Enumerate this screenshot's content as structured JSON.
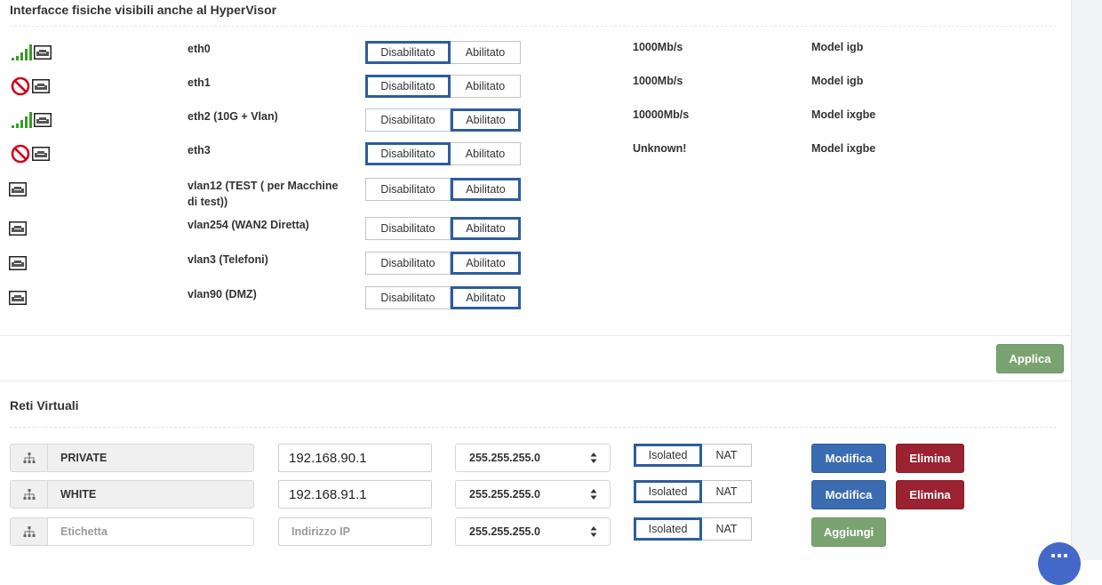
{
  "physical": {
    "title": "Interfacce fisiche visibili anche al HyperVisor",
    "off_label": "Disabilitato",
    "on_label": "Abilitato",
    "interfaces": [
      {
        "name": "eth0",
        "speed": "1000Mb/s",
        "model": "Model igb",
        "state": "off",
        "status_icon": "signal-icon"
      },
      {
        "name": "eth1",
        "speed": "1000Mb/s",
        "model": "Model igb",
        "state": "off",
        "status_icon": "ban-icon"
      },
      {
        "name": "eth2 (10G + Vlan)",
        "speed": "10000Mb/s",
        "model": "Model ixgbe",
        "state": "on",
        "status_icon": "signal-icon"
      },
      {
        "name": "eth3",
        "speed": "Unknown!",
        "model": "Model ixgbe",
        "state": "off",
        "status_icon": "ban-icon"
      },
      {
        "name": "vlan12 (TEST ( per Macchine di test))",
        "speed": "",
        "model": "",
        "state": "on",
        "status_icon": ""
      },
      {
        "name": "vlan254 (WAN2 Diretta)",
        "speed": "",
        "model": "",
        "state": "on",
        "status_icon": ""
      },
      {
        "name": "vlan3 (Telefoni)",
        "speed": "",
        "model": "",
        "state": "on",
        "status_icon": ""
      },
      {
        "name": "vlan90 (DMZ)",
        "speed": "",
        "model": "",
        "state": "on",
        "status_icon": ""
      }
    ],
    "apply_label": "Applica"
  },
  "virtual": {
    "title": "Reti Virtuali",
    "isolated_label": "Isolated",
    "nat_label": "NAT",
    "edit_label": "Modifica",
    "delete_label": "Elimina",
    "add_label": "Aggiungi",
    "label_placeholder": "Etichetta",
    "ip_placeholder": "Indirizzo IP",
    "networks": [
      {
        "label": "PRIVATE",
        "ip": "192.168.90.1",
        "mask": "255.255.255.0",
        "mode": "isolated"
      },
      {
        "label": "WHITE",
        "ip": "192.168.91.1",
        "mask": "255.255.255.0",
        "mode": "isolated"
      }
    ],
    "new_network": {
      "label": "",
      "ip": "",
      "mask": "255.255.255.0",
      "mode": "isolated"
    }
  },
  "colors": {
    "active_border": "#2d5d9c",
    "apply_green": "#7aa371",
    "edit_blue": "#3b6bb0",
    "delete_red": "#9b2230",
    "signal_green": "#3a9a2a",
    "ban_red": "#d0021b",
    "fab_blue": "#4468c7"
  }
}
